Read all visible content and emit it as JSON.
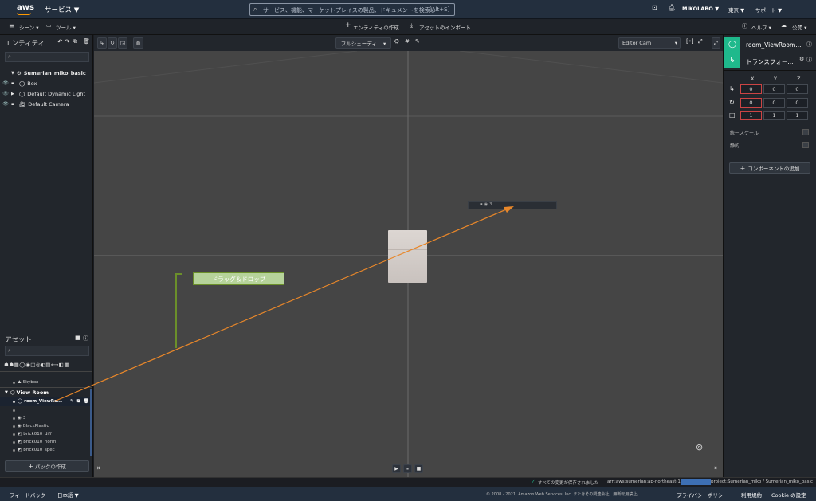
{
  "topbar": {
    "logo": "aws",
    "services": "サービス ▼",
    "search_placeholder": "サービス、機能、マーケットプレイスの製品、ドキュメントを検索し",
    "search_shortcut": "[Alt+S]",
    "account": "MIKOLABO ▼",
    "region": "東京 ▼",
    "support": "サポート ▼"
  },
  "menubar": {
    "scene": "シーン ▾",
    "tools": "ツール ▾",
    "create_entity": "エンティティの作成",
    "import_asset": "アセットのインポート",
    "help": "ヘルプ ▾",
    "publish": "公開 ▾"
  },
  "entities": {
    "title": "エンティティ",
    "root": "Sumerian_miko_basic",
    "items": [
      "Box",
      "Default Dynamic Light",
      "Default Camera"
    ]
  },
  "viewport": {
    "shading": "フルシェーディ... ▾",
    "camera": "Editor Cam",
    "label_annotation": "ドラッグ＆ドロップ",
    "drop_target": "3"
  },
  "inspector": {
    "entity_name": "room_ViewRoom...",
    "component": "トランスフォー...",
    "axes": [
      "X",
      "Y",
      "Z"
    ],
    "translation": [
      "0",
      "0",
      "0"
    ],
    "rotation": [
      "0",
      "0",
      "0"
    ],
    "scale": [
      "1",
      "1",
      "1"
    ],
    "uniform_scale": "統一スケール",
    "static": "静的",
    "add_component": "コンポーネントの追加"
  },
  "assets": {
    "title": "アセット",
    "skybox": "Skybox",
    "pack": "View Room",
    "items": [
      "room_ViewRo...",
      "",
      "3",
      "BlackPlastic",
      "brick010_diff",
      "brick010_norm",
      "brick010_spec"
    ],
    "create_pack": "パックの作成"
  },
  "statusbar": {
    "saved": "すべての変更が保存されました",
    "arn": "arn:aws:sumerian:ap-northeast-1",
    "project": "project:Sumerian_miko / Sumerian_miko_basic"
  },
  "footer": {
    "feedback": "フィードバック",
    "language": "日本語 ▼",
    "copyright": "© 2008 - 2021, Amazon Web Services, Inc. またはその関連会社。無断転用禁止。",
    "privacy": "プライバシーポリシー",
    "terms": "利用規約",
    "cookie": "Cookie の設定"
  },
  "colors": {
    "accent_green": "#1fb98c",
    "annotation_orange": "#e8872a",
    "annotation_green": "#6b8f2a",
    "label_bg": "#b6d39a"
  }
}
